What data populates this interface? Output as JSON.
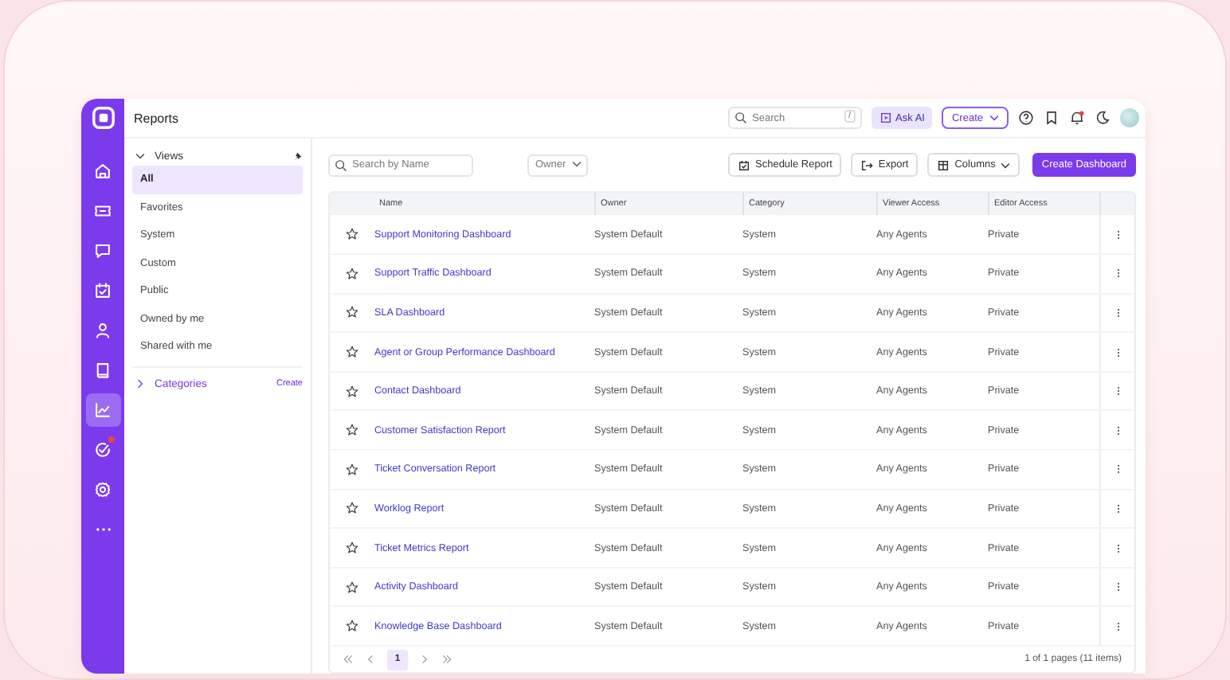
{
  "header": {
    "title": "Reports",
    "search": {
      "placeholder": "Search",
      "shortcut": "/"
    },
    "ask_ai": "Ask AI",
    "create": "Create"
  },
  "rail": [
    {
      "kind": "home",
      "selected": false,
      "badge": false
    },
    {
      "kind": "ticket",
      "selected": false,
      "badge": false
    },
    {
      "kind": "chat",
      "selected": false,
      "badge": false
    },
    {
      "kind": "calendar",
      "selected": false,
      "badge": false
    },
    {
      "kind": "person",
      "selected": false,
      "badge": false
    },
    {
      "kind": "book",
      "selected": false,
      "badge": false
    },
    {
      "kind": "chart",
      "selected": true,
      "badge": false
    },
    {
      "kind": "goal",
      "selected": false,
      "badge": true
    },
    {
      "kind": "gear",
      "selected": false,
      "badge": false
    },
    {
      "kind": "more",
      "selected": false,
      "badge": false
    }
  ],
  "views": {
    "label": "Views",
    "expanded": true,
    "items": [
      {
        "label": "All",
        "selected": true
      },
      {
        "label": "Favorites",
        "selected": false
      },
      {
        "label": "System",
        "selected": false
      },
      {
        "label": "Custom",
        "selected": false
      },
      {
        "label": "Public",
        "selected": false
      },
      {
        "label": "Owned by me",
        "selected": false
      },
      {
        "label": "Shared with me",
        "selected": false
      }
    ]
  },
  "categories": {
    "label": "Categories",
    "expanded": false,
    "action": "Create"
  },
  "toolbar": {
    "search_placeholder": "Search by Name",
    "owner_placeholder": "Owner",
    "buttons": [
      {
        "kind": "schedule",
        "label": "Schedule Report"
      },
      {
        "kind": "export",
        "label": "Export"
      },
      {
        "kind": "columns",
        "label": "Columns"
      },
      {
        "kind": "primary",
        "label": "Create Dashboard"
      }
    ]
  },
  "table": {
    "columns": [
      "Name",
      "Owner",
      "Category",
      "Viewer Access",
      "Editor Access"
    ],
    "rows": [
      {
        "name": "Support Monitoring Dashboard",
        "owner": "System Default",
        "category": "System",
        "viewer_access": "Any Agents",
        "editor_access": "Private"
      },
      {
        "name": "Support Traffic Dashboard",
        "owner": "System Default",
        "category": "System",
        "viewer_access": "Any Agents",
        "editor_access": "Private"
      },
      {
        "name": "SLA Dashboard",
        "owner": "System Default",
        "category": "System",
        "viewer_access": "Any Agents",
        "editor_access": "Private"
      },
      {
        "name": "Agent or Group Performance Dashboard",
        "owner": "System Default",
        "category": "System",
        "viewer_access": "Any Agents",
        "editor_access": "Private"
      },
      {
        "name": "Contact Dashboard",
        "owner": "System Default",
        "category": "System",
        "viewer_access": "Any Agents",
        "editor_access": "Private"
      },
      {
        "name": "Customer Satisfaction Report",
        "owner": "System Default",
        "category": "System",
        "viewer_access": "Any Agents",
        "editor_access": "Private"
      },
      {
        "name": "Ticket Conversation Report",
        "owner": "System Default",
        "category": "System",
        "viewer_access": "Any Agents",
        "editor_access": "Private"
      },
      {
        "name": "Worklog Report",
        "owner": "System Default",
        "category": "System",
        "viewer_access": "Any Agents",
        "editor_access": "Private"
      },
      {
        "name": "Ticket Metrics Report",
        "owner": "System Default",
        "category": "System",
        "viewer_access": "Any Agents",
        "editor_access": "Private"
      },
      {
        "name": "Activity Dashboard",
        "owner": "System Default",
        "category": "System",
        "viewer_access": "Any Agents",
        "editor_access": "Private"
      },
      {
        "name": "Knowledge Base Dashboard",
        "owner": "System Default",
        "category": "System",
        "viewer_access": "Any Agents",
        "editor_access": "Private"
      }
    ]
  },
  "pagination": {
    "pages": [
      {
        "label": "1",
        "selected": true
      }
    ],
    "summary": "1 of 1 pages (11 items)"
  }
}
